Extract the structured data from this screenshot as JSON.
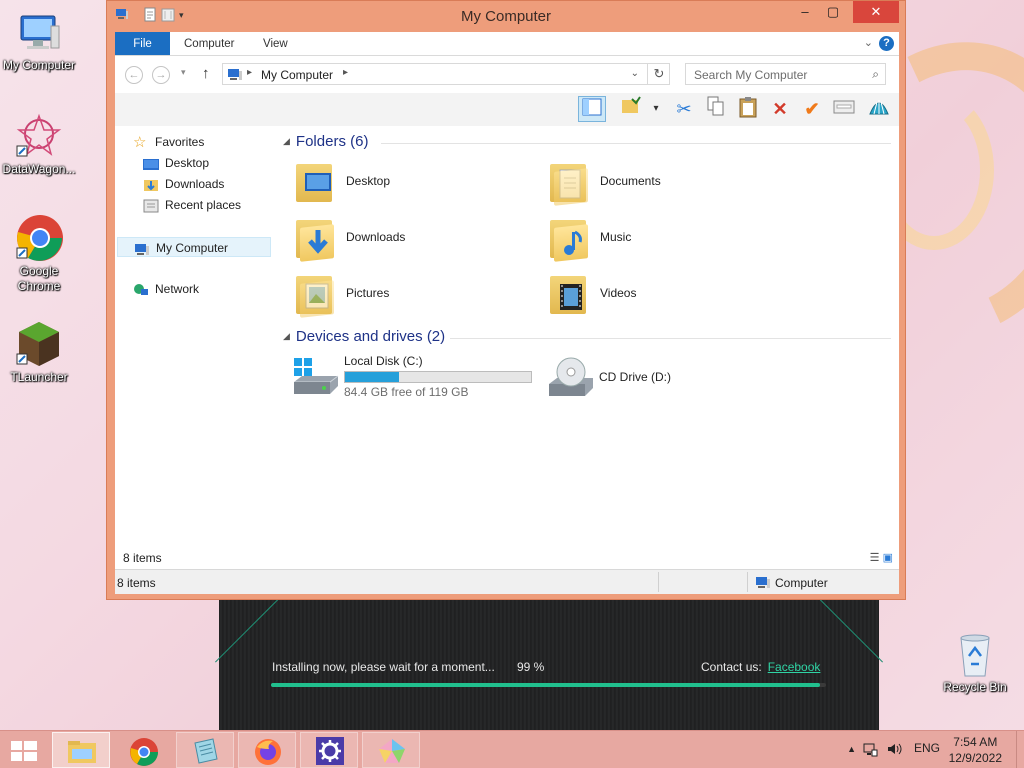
{
  "desktop": {
    "icons": [
      {
        "label": "My Computer"
      },
      {
        "label": "DataWagon..."
      },
      {
        "label": "Google Chrome"
      },
      {
        "label": "TLauncher"
      },
      {
        "label": "Recycle Bin"
      }
    ]
  },
  "installer": {
    "message": "Installing now, please wait for a moment...",
    "percent_text": "99 %",
    "progress": 0.99,
    "contact_label": "Contact us:",
    "contact_link": "Facebook"
  },
  "window": {
    "title": "My Computer",
    "tabs": {
      "file": "File",
      "computer": "Computer",
      "view": "View"
    },
    "address": {
      "location": "My Computer",
      "search_placeholder": "Search My Computer"
    },
    "nav": {
      "favorites": "Favorites",
      "desktop": "Desktop",
      "downloads": "Downloads",
      "recent": "Recent places",
      "my_computer": "My Computer",
      "network": "Network"
    },
    "folders_heading": "Folders (6)",
    "folders": [
      {
        "label": "Desktop"
      },
      {
        "label": "Documents"
      },
      {
        "label": "Downloads"
      },
      {
        "label": "Music"
      },
      {
        "label": "Pictures"
      },
      {
        "label": "Videos"
      }
    ],
    "drives_heading": "Devices and drives (2)",
    "drives": {
      "local": {
        "label": "Local Disk (C:)",
        "free_text": "84.4 GB free of 119 GB",
        "used_fraction": 0.29
      },
      "cd": {
        "label": "CD Drive (D:)"
      }
    },
    "items_count": "8 items",
    "status_left": "8 items",
    "status_right": "Computer"
  },
  "taskbar": {
    "language": "ENG",
    "time": "7:54 AM",
    "date": "12/9/2022"
  },
  "colors": {
    "window_frame": "#ee9d7b",
    "close_button": "#d9463c",
    "file_tab": "#1b6ec2",
    "heading_blue": "#1e3287",
    "installer_green": "#21c08e",
    "drive_bar": "#26a0da",
    "taskbar": "#e7a8a1"
  }
}
